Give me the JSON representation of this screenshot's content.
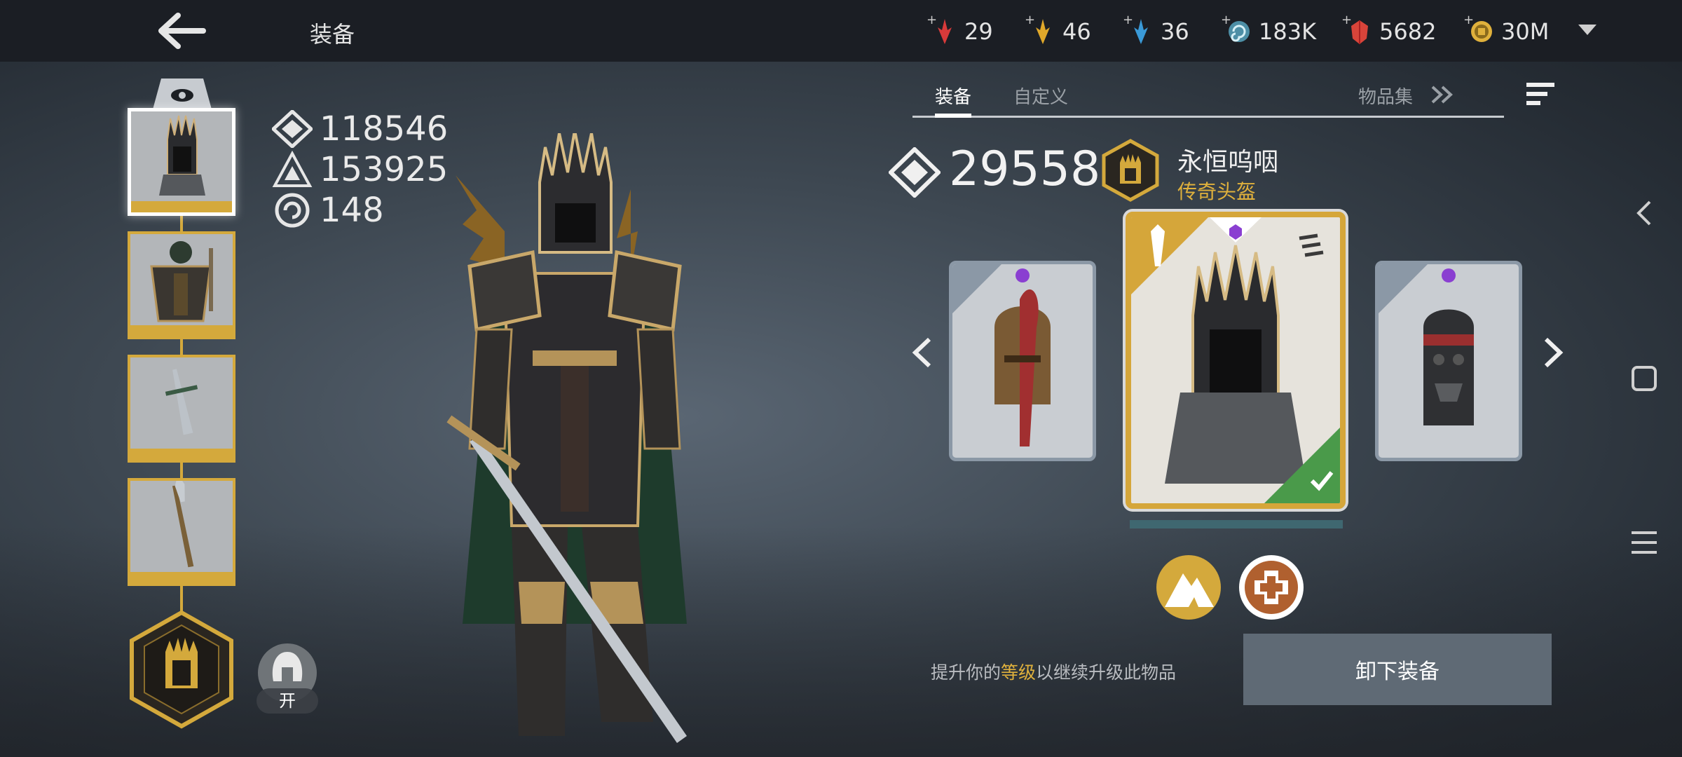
{
  "header": {
    "title": "装备",
    "resources": [
      {
        "icon": "red-crystal-icon",
        "value": "29",
        "color": "#d83a3a"
      },
      {
        "icon": "gold-crystal-icon",
        "value": "46",
        "color": "#e0a82a"
      },
      {
        "icon": "blue-crystal-icon",
        "value": "36",
        "color": "#3a9ad8"
      },
      {
        "icon": "spiral-essence-icon",
        "value": "183K",
        "color": "#7fc4d8"
      },
      {
        "icon": "ruby-shard-icon",
        "value": "5682",
        "color": "#d8443a"
      },
      {
        "icon": "gold-coin-icon",
        "value": "30M",
        "color": "#e0b13c"
      }
    ]
  },
  "stats": [
    {
      "icon": "power-diamond-icon",
      "value": "118546"
    },
    {
      "icon": "triforce-icon",
      "value": "153925"
    },
    {
      "icon": "spiral-icon",
      "value": "148"
    }
  ],
  "toggle": {
    "label": "开"
  },
  "tabs": {
    "equip": "装备",
    "custom": "自定义",
    "collection": "物品集"
  },
  "item": {
    "power": "29558",
    "name": "永恒呜咽",
    "type": "传奇头盔"
  },
  "hint": {
    "prefix": "提升你的",
    "highlight": "等级",
    "suffix": "以继续升级此物品"
  },
  "actions": {
    "unequip": "卸下装备"
  },
  "colors": {
    "accent_gold": "#d4a93c",
    "legendary_text": "#e0b13c",
    "equipped_green": "#4a9a4a",
    "button_bg": "#5f6a75"
  }
}
